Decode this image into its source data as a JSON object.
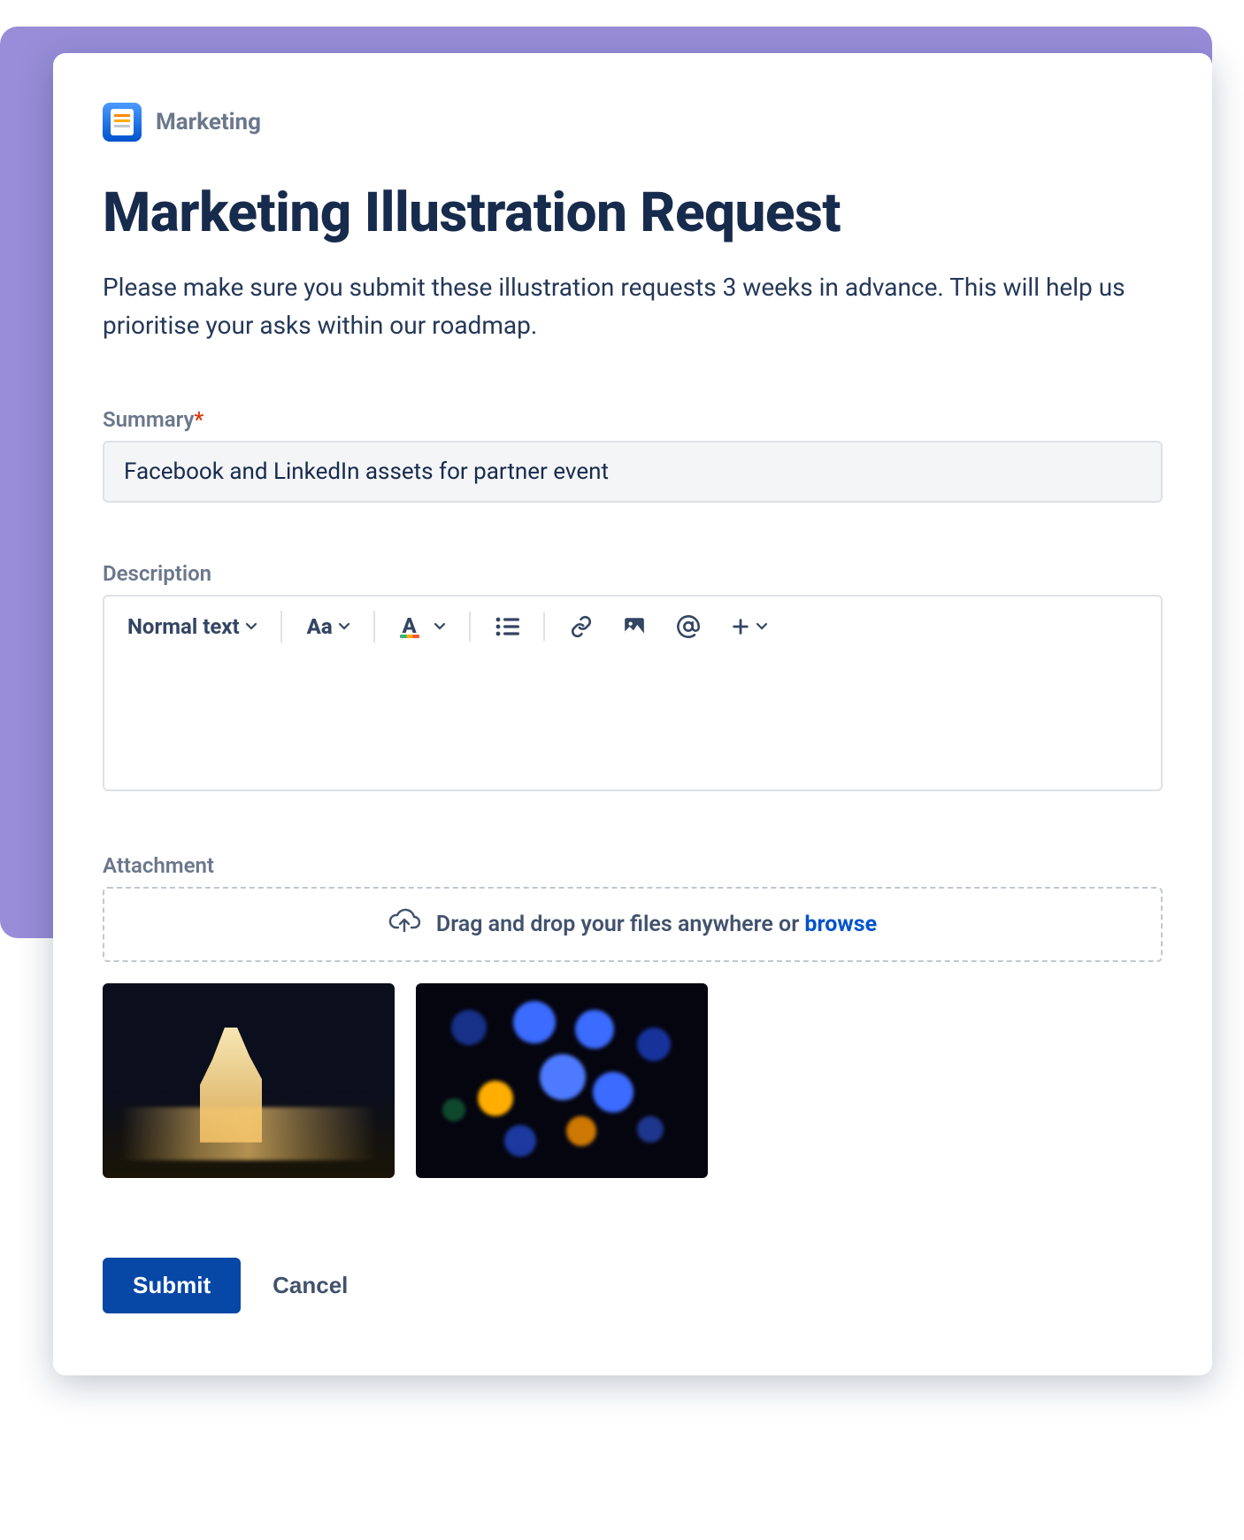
{
  "breadcrumb": {
    "label": "Marketing"
  },
  "header": {
    "title": "Marketing Illustration Request",
    "description": "Please make sure you submit these illustration requests 3 weeks in advance. This will help us prioritise your asks within our roadmap."
  },
  "fields": {
    "summary": {
      "label": "Summary",
      "required_marker": "*",
      "value": "Facebook and LinkedIn assets for partner event"
    },
    "description": {
      "label": "Description",
      "value": ""
    },
    "attachment": {
      "label": "Attachment",
      "dropzone_text": "Drag and drop your files anywhere or ",
      "browse_label": "browse"
    }
  },
  "toolbar": {
    "text_style": "Normal text",
    "format_label": "Aa",
    "color_label": "A",
    "icons": {
      "list": "bullet-list-icon",
      "link": "link-icon",
      "image": "image-icon",
      "mention": "mention-icon",
      "more": "plus-icon"
    }
  },
  "actions": {
    "submit": "Submit",
    "cancel": "Cancel"
  },
  "colors": {
    "primary": "#0747A6",
    "link": "#0052CC",
    "text_dark": "#172B4D",
    "text_muted": "#6B778C",
    "border": "#DFE1E6",
    "required": "#DE350B",
    "purple_bg": "#998DD9"
  }
}
